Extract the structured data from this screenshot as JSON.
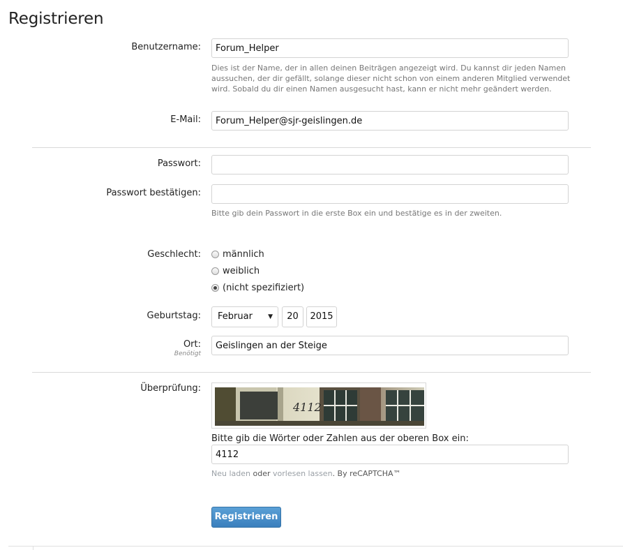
{
  "page_title": "Registrieren",
  "username": {
    "label": "Benutzername:",
    "value": "Forum_Helper",
    "hint": "Dies ist der Name, der in allen deinen Beiträgen angezeigt wird. Du kannst dir jeden Namen aussuchen, der dir gefällt, solange dieser nicht schon von einem anderen Mitglied verwendet wird. Sobald du dir einen Namen ausgesucht hast, kann er nicht mehr geändert werden."
  },
  "email": {
    "label": "E-Mail:",
    "value": "Forum_Helper@sjr-geislingen.de"
  },
  "password": {
    "label": "Passwort:",
    "value": ""
  },
  "password_confirm": {
    "label": "Passwort bestätigen:",
    "value": "",
    "hint": "Bitte gib dein Passwort in die erste Box ein und bestätige es in der zweiten."
  },
  "gender": {
    "label": "Geschlecht:",
    "options": [
      "männlich",
      "weiblich",
      "(nicht spezifiziert)"
    ],
    "selected": "(nicht spezifiziert)"
  },
  "birthday": {
    "label": "Geburtstag:",
    "month": "Februar",
    "day": "20",
    "year": "2015"
  },
  "location": {
    "label": "Ort:",
    "required_note": "Benötigt",
    "value": "Geislingen an der Steige"
  },
  "verification": {
    "label": "Überprüfung:",
    "captcha_text": "4112",
    "prompt": "Bitte gib die Wörter oder Zahlen aus der oberen Box ein:",
    "value": "4112",
    "reload_label": "Neu laden",
    "or_label": "oder",
    "audio_label": "vorlesen lassen",
    "by_label": ". By reCAPTCHA™"
  },
  "submit_label": "Registrieren",
  "colors": {
    "button": "#3a7fbd",
    "hint_text": "#777777",
    "link_text": "#9aa0a6"
  }
}
